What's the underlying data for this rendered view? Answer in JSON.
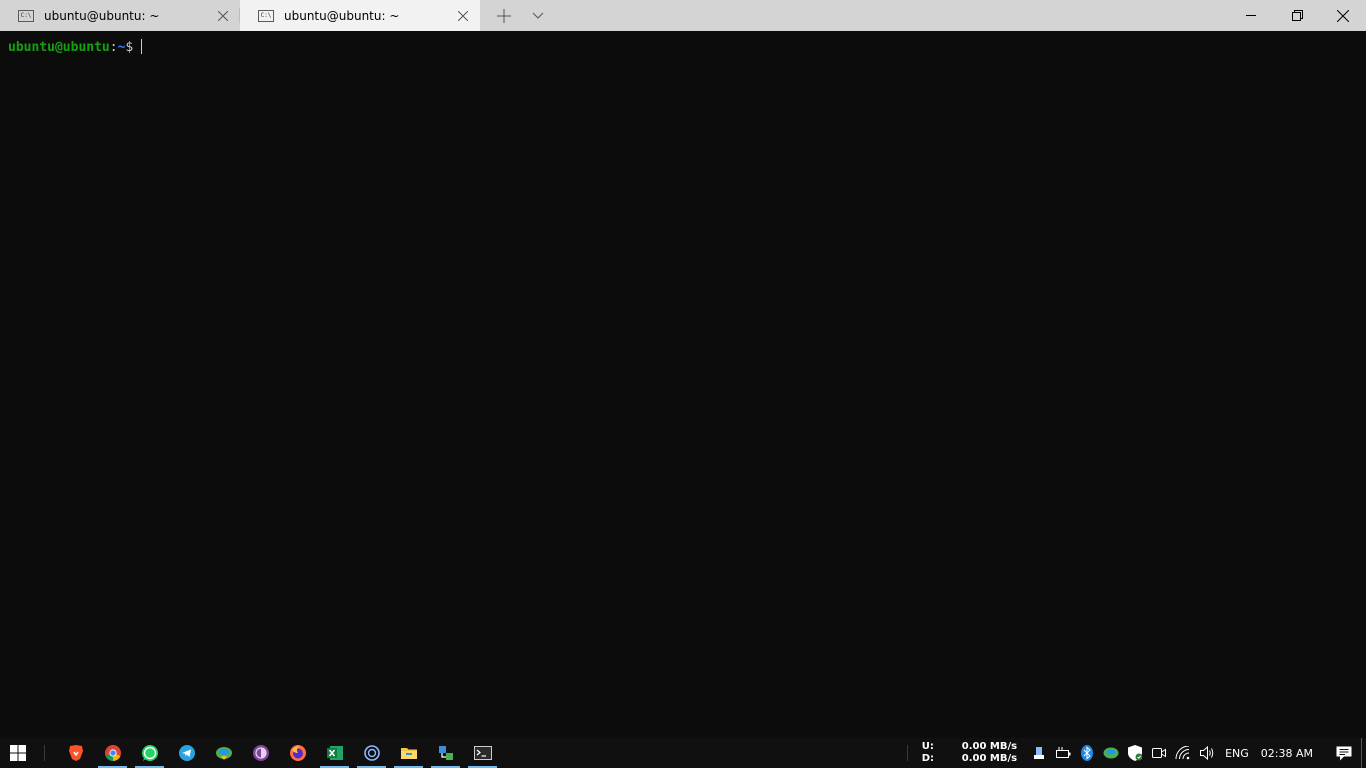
{
  "tabs": [
    {
      "label": "ubuntu@ubuntu: ~",
      "icon": "terminal-tab-icon",
      "active": false
    },
    {
      "label": "ubuntu@ubuntu: ~",
      "icon": "terminal-tab-icon",
      "active": true
    }
  ],
  "tab_icon_text": "C:\\",
  "terminal": {
    "user_host": "ubuntu@ubuntu",
    "colon": ":",
    "path": "~",
    "dollar": "$",
    "colors": {
      "background": "#0c0c0c",
      "user": "#13a10e",
      "path": "#3b78ff",
      "text": "#cccccc"
    }
  },
  "taskbar": {
    "apps": [
      {
        "name": "brave-icon",
        "color": "#fb542b"
      },
      {
        "name": "chrome-icon",
        "color": "#4285f4"
      },
      {
        "name": "whatsapp-icon",
        "color": "#25d366"
      },
      {
        "name": "telegram-icon",
        "color": "#2aa3df"
      },
      {
        "name": "idm-icon",
        "color": "#4caf50"
      },
      {
        "name": "tor-browser-icon",
        "color": "#7d4698"
      },
      {
        "name": "firefox-icon",
        "color": "#ff7139"
      },
      {
        "name": "excel-icon",
        "color": "#1d6f42"
      },
      {
        "name": "cortana-icon",
        "color": "#8fb8ff"
      },
      {
        "name": "file-explorer-icon",
        "color": "#f5c542"
      },
      {
        "name": "network-app-icon",
        "color": "#3b8fd9"
      },
      {
        "name": "windows-terminal-icon",
        "color": "#cccccc"
      }
    ],
    "net_upload_label": "U:",
    "net_download_label": "D:",
    "net_upload_value": "0.00 MB/s",
    "net_download_value": "0.00 MB/s",
    "language": "ENG",
    "time": "02:38 AM",
    "accent": "#76b9ed"
  }
}
